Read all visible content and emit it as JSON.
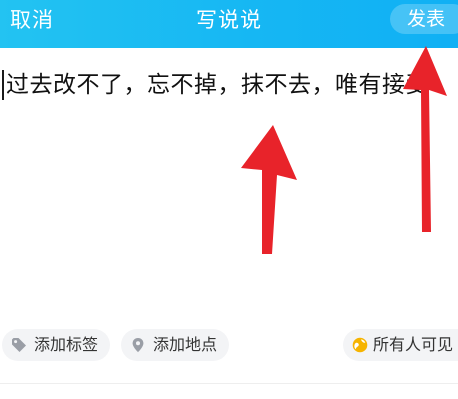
{
  "header": {
    "cancel_label": "取消",
    "title": "写说说",
    "publish_label": "发表",
    "gradient_start": "#23c3f2",
    "gradient_end": "#10b0f4"
  },
  "editor": {
    "text": "过去改不了，忘不掉，抹不去，唯有接受"
  },
  "chips": {
    "add_tag": {
      "label": "添加标签",
      "icon": "tag-icon"
    },
    "add_location": {
      "label": "添加地点",
      "icon": "location-pin-icon"
    },
    "visibility": {
      "label": "所有人可见",
      "icon": "visibility-globe-icon"
    }
  },
  "annotations": {
    "arrow_color": "#e8232a",
    "arrows": [
      "arrow-to-text-icon",
      "arrow-to-publish-icon"
    ]
  }
}
